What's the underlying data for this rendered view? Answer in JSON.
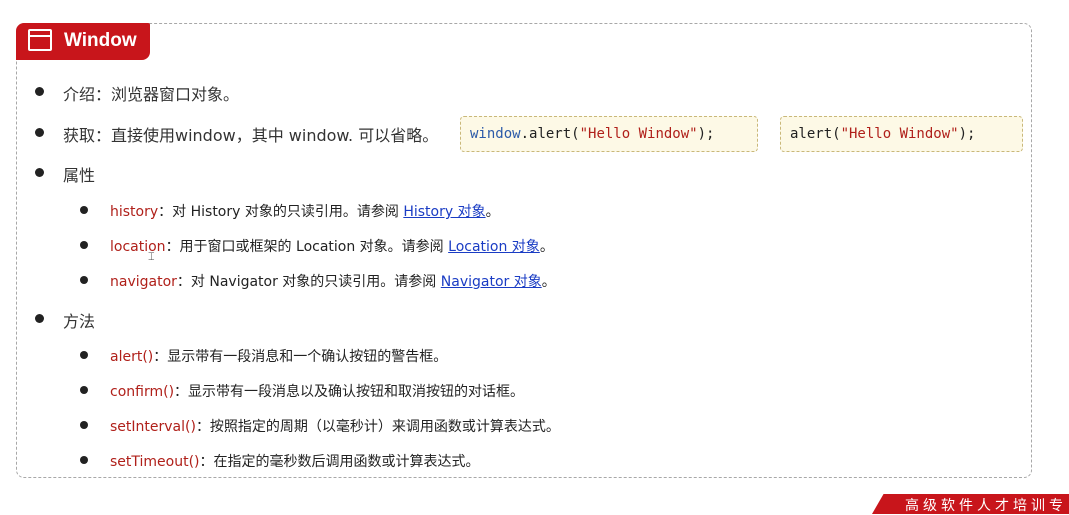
{
  "title": "Window",
  "items": {
    "intro": "介绍：浏览器窗口对象。",
    "get": "获取：直接使用window，其中 window. 可以省略。",
    "props_heading": "属性",
    "methods_heading": "方法"
  },
  "code_examples": [
    {
      "obj": "window",
      "dot": ".",
      "method": "alert(",
      "str": "\"Hello Window\"",
      "end": ");"
    },
    {
      "method": "alert(",
      "str": "\"Hello Window\"",
      "end": ");"
    }
  ],
  "properties": [
    {
      "name": "history",
      "desc": "：对 History 对象的只读引用。请参阅 ",
      "link": "History 对象",
      "end": "。"
    },
    {
      "name": "location",
      "desc": "：用于窗口或框架的 Location 对象。请参阅 ",
      "link": "Location 对象",
      "end": "。"
    },
    {
      "name": "navigator",
      "desc": "：对 Navigator 对象的只读引用。请参阅 ",
      "link": "Navigator 对象",
      "end": "。"
    }
  ],
  "methods": [
    {
      "name": "alert()",
      "desc": "：显示带有一段消息和一个确认按钮的警告框。"
    },
    {
      "name": "confirm()",
      "desc": "：显示带有一段消息以及确认按钮和取消按钮的对话框。"
    },
    {
      "name": "setInterval()",
      "desc": "：按照指定的周期（以毫秒计）来调用函数或计算表达式。"
    },
    {
      "name": "setTimeout()",
      "desc": "：在指定的毫秒数后调用函数或计算表达式。"
    }
  ],
  "footer_banner": "高级软件人才培训专",
  "colors": {
    "accent": "#c8151b",
    "keyword": "#b0201a",
    "link": "#1a3cc4",
    "code_bg": "#fdf9e6"
  }
}
